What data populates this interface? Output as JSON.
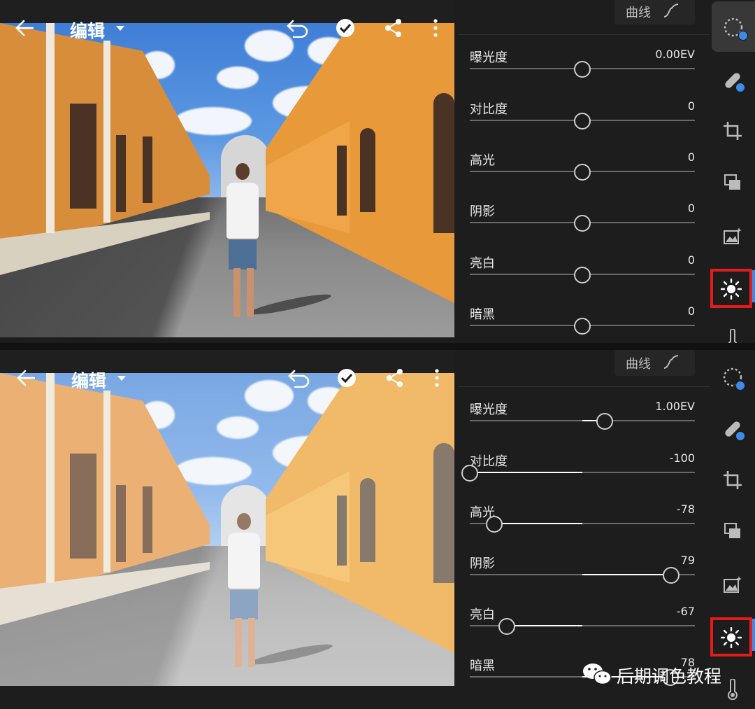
{
  "screens": [
    {
      "header": {
        "title": "编辑"
      },
      "curve_button": {
        "label": "曲线"
      },
      "sliders": [
        {
          "label": "曝光度",
          "value": "0.00EV",
          "position": 0.5
        },
        {
          "label": "对比度",
          "value": "0",
          "position": 0.5
        },
        {
          "label": "高光",
          "value": "0",
          "position": 0.5
        },
        {
          "label": "阴影",
          "value": "0",
          "position": 0.5
        },
        {
          "label": "亮白",
          "value": "0",
          "position": 0.5
        },
        {
          "label": "暗黑",
          "value": "0",
          "position": 0.5
        }
      ]
    },
    {
      "header": {
        "title": "编辑"
      },
      "curve_button": {
        "label": "曲线"
      },
      "sliders": [
        {
          "label": "曝光度",
          "value": "1.00EV",
          "position": 0.6
        },
        {
          "label": "对比度",
          "value": "-100",
          "position": 0.0
        },
        {
          "label": "高光",
          "value": "-78",
          "position": 0.11
        },
        {
          "label": "阴影",
          "value": "79",
          "position": 0.895
        },
        {
          "label": "亮白",
          "value": "-67",
          "position": 0.165
        },
        {
          "label": "暗黑",
          "value": "78",
          "position": 0.89
        }
      ]
    }
  ],
  "toolbar": {
    "tools": [
      "selective-icon",
      "healing-icon",
      "crop-icon",
      "layers-icon",
      "enhance-icon",
      "light-icon",
      "temperature-icon"
    ],
    "active_tool": "light-icon",
    "accent_color": "#3c8bea",
    "highlight_color": "#e31b1b"
  },
  "watermark": {
    "text": "后期调色教程"
  }
}
